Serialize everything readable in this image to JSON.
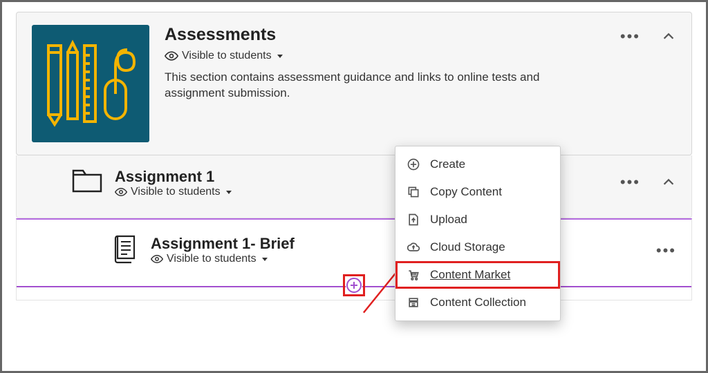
{
  "module": {
    "title": "Assessments",
    "visibility": "Visible to students",
    "description": "This section contains assessment guidance and links to online tests and assignment submission."
  },
  "sub1": {
    "title": "Assignment 1",
    "visibility": "Visible to students"
  },
  "sub2": {
    "title": "Assignment 1- Brief",
    "visibility": "Visible to students"
  },
  "menu": {
    "items": [
      {
        "label": "Create"
      },
      {
        "label": "Copy Content"
      },
      {
        "label": "Upload"
      },
      {
        "label": "Cloud Storage"
      },
      {
        "label": "Content Market"
      },
      {
        "label": "Content Collection"
      }
    ]
  }
}
